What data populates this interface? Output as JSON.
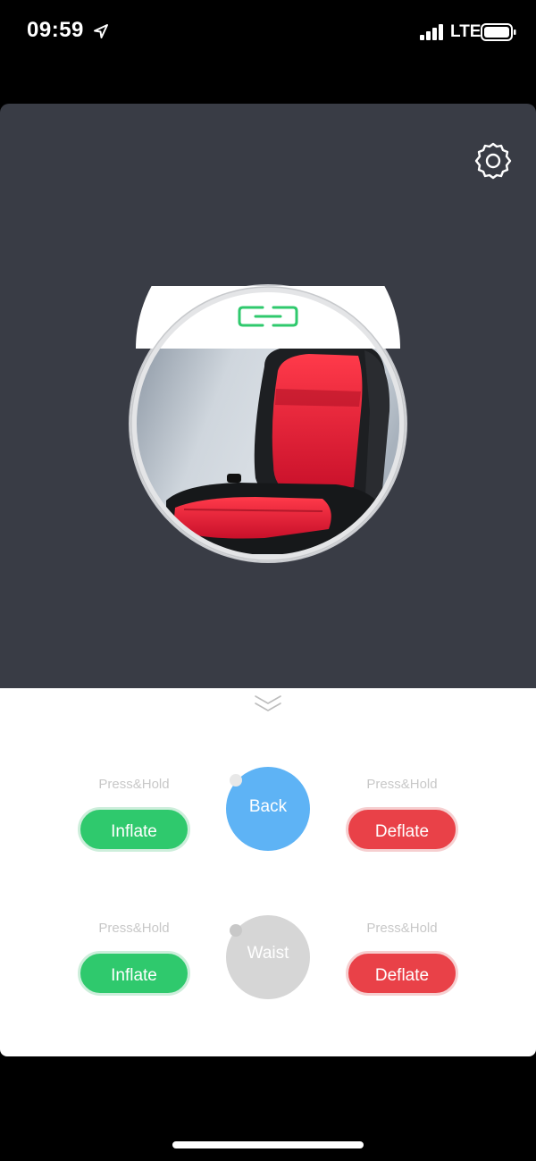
{
  "status_bar": {
    "time": "09:59",
    "network": "LTE",
    "icons": [
      "location-arrow-icon",
      "signal-icon",
      "battery-icon"
    ]
  },
  "header": {
    "settings_icon": "gear-icon",
    "connection_icon": "link-icon"
  },
  "seat": {
    "image_desc": "seat-image"
  },
  "controls": {
    "collapse_icon": "chevron-down-icon",
    "back_row": {
      "zone_label": "Back",
      "inflate": {
        "hint": "Press&Hold",
        "label": "Inflate"
      },
      "deflate": {
        "hint": "Press&Hold",
        "label": "Deflate"
      },
      "state": "active"
    },
    "waist_row": {
      "zone_label": "Waist",
      "inflate": {
        "hint": "Press&Hold",
        "label": "Inflate"
      },
      "deflate": {
        "hint": "Press&Hold",
        "label": "Deflate"
      },
      "state": "inactive"
    }
  },
  "colors": {
    "panel": "#393c45",
    "accent_green": "#2fc96d",
    "accent_red": "#e94148",
    "accent_blue": "#5eb3f5",
    "inactive_gray": "#d6d6d6"
  }
}
